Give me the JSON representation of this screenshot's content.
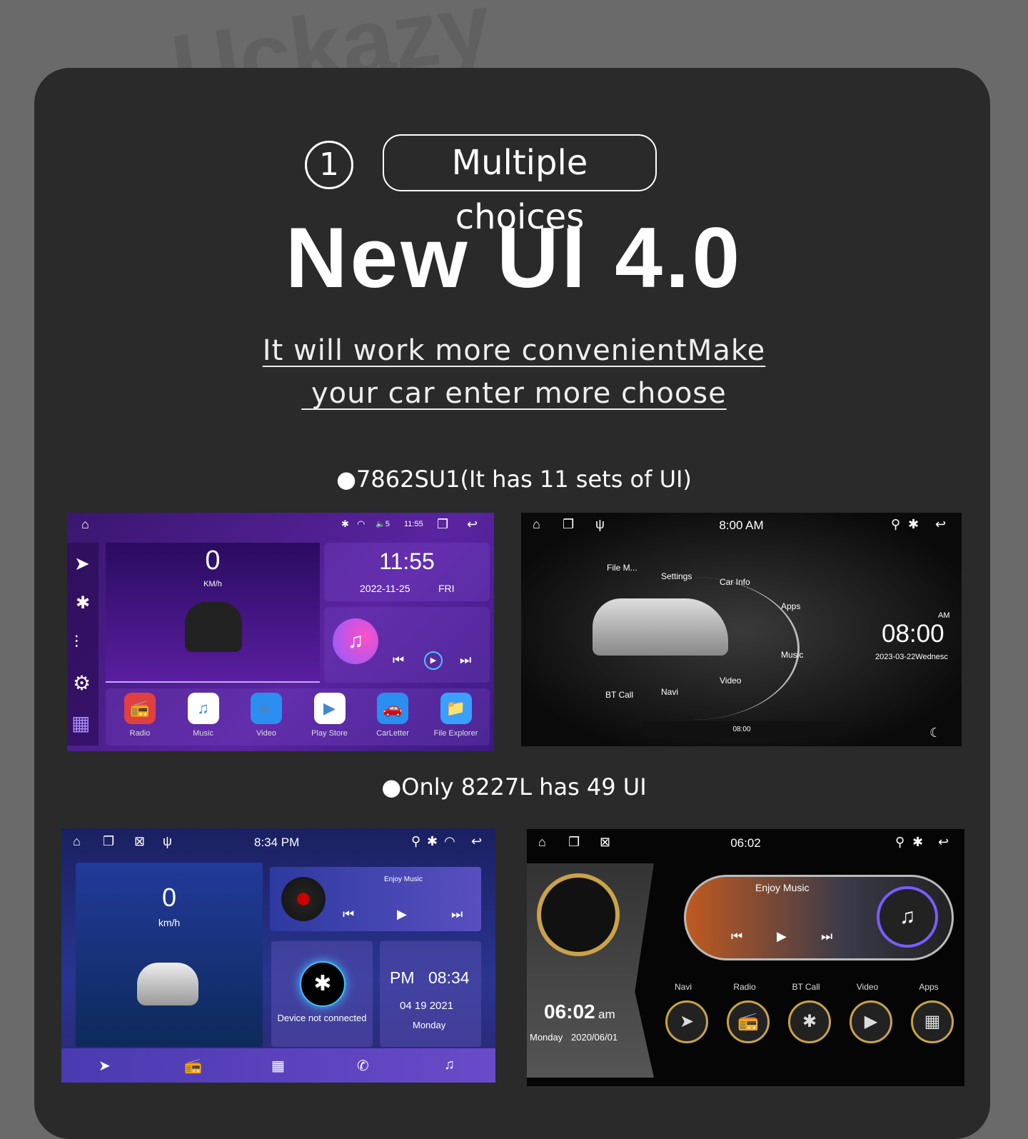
{
  "watermark": "Uckazy",
  "header": {
    "step_number": "1",
    "badge": "Multiple choices",
    "title": "New UI 4.0",
    "subtitle_line1": "It will work more convenientMake",
    "subtitle_line2": " your car enter more choose"
  },
  "section1": {
    "label": "●7862SU1(It has 11 sets of UI)"
  },
  "section2": {
    "label": "●Only 8227L has 49 UI"
  },
  "ui1": {
    "status_time": "11:55",
    "volume": "5",
    "speed": "0",
    "speed_unit": "KM/h",
    "clock": "11:55",
    "date": "2022-11-25",
    "weekday": "FRI",
    "apps": [
      "Radio",
      "Music",
      "Video",
      "Play Store",
      "CarLetter",
      "File Explorer"
    ]
  },
  "ui2": {
    "status_time": "8:00 AM",
    "menu": [
      "File M...",
      "Settings",
      "Car Info",
      "Apps",
      "Music",
      "Video",
      "Navi",
      "BT Call"
    ],
    "ampm": "AM",
    "clock": "08:00",
    "date": "2023-03-22Wednesc",
    "bottom_time": "08:00"
  },
  "ui3": {
    "status_time": "8:34 PM",
    "speed": "0",
    "speed_unit": "km/h",
    "music_title": "Enjoy Music",
    "bt_status": "Device not connected",
    "ampm": "PM",
    "clock": "08:34",
    "date": "04 19 2021",
    "weekday": "Monday"
  },
  "ui4": {
    "status_time": "06:02",
    "music_title": "Enjoy Music",
    "clock": "06:02",
    "ampm": "am",
    "weekday": "Monday",
    "date": "2020/06/01",
    "apps": [
      "Navi",
      "Radio",
      "BT Call",
      "Video",
      "Apps"
    ]
  }
}
